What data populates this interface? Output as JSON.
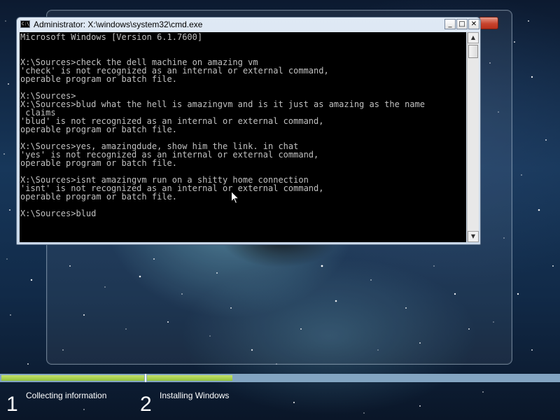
{
  "console_window": {
    "title": "Administrator: X:\\windows\\system32\\cmd.exe",
    "icon": "cmd-icon",
    "buttons": {
      "minimize": "_",
      "maximize": "□",
      "close": "✕"
    },
    "lines": [
      "Microsoft Windows [Version 6.1.7600]",
      "",
      "",
      "X:\\Sources>check the dell machine on amazing vm",
      "'check' is not recognized as an internal or external command,",
      "operable program or batch file.",
      "",
      "X:\\Sources>",
      "X:\\Sources>blud what the hell is amazingvm and is it just as amazing as the name",
      " claims",
      "'blud' is not recognized as an internal or external command,",
      "operable program or batch file.",
      "",
      "X:\\Sources>yes, amazingdude, show him the link. in chat",
      "'yes' is not recognized as an internal or external command,",
      "operable program or batch file.",
      "",
      "X:\\Sources>isnt amazingvm run on a shitty home connection",
      "'isnt' is not recognized as an internal or external command,",
      "operable program or batch file.",
      "",
      "X:\\Sources>blud"
    ],
    "colors": {
      "background": "#000000",
      "text": "#c0c0c0"
    }
  },
  "setup_progress": {
    "steps": [
      {
        "number": "1",
        "label": "Collecting information",
        "progress": 1.0
      },
      {
        "number": "2",
        "label": "Installing Windows",
        "progress": 0.2
      }
    ],
    "colors": {
      "fill": "#93c23b",
      "track": "#83a5c2"
    }
  }
}
